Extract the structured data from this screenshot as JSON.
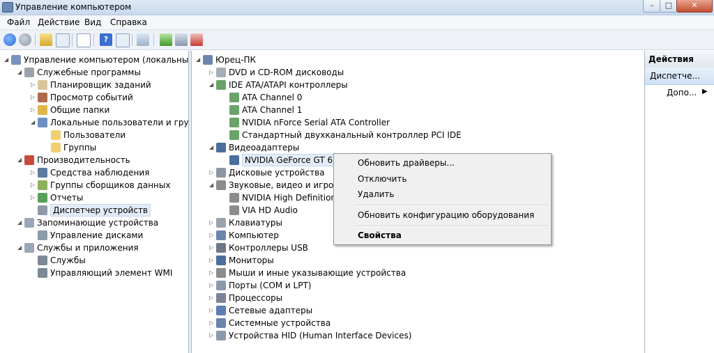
{
  "window": {
    "title": "Управление компьютером",
    "minimize": "–",
    "maximize": "□",
    "close": "✕"
  },
  "menu": [
    "Файл",
    "Действие",
    "Вид",
    "Справка"
  ],
  "toolbar_icons": [
    "back-icon",
    "forward-icon",
    "up-folder-icon",
    "show-hide-tree-icon",
    "properties-icon",
    "help-icon",
    "show-hide-action-icon",
    "scan-hardware-icon",
    "update-driver-icon",
    "disable-device-icon",
    "uninstall-device-icon"
  ],
  "left_tree": [
    {
      "label": "Управление компьютером (локальным)",
      "icon": "computer-management-icon"
    },
    {
      "label": "Служебные программы",
      "icon": "tools-icon"
    },
    {
      "label": "Планировщик заданий",
      "icon": "clock-icon"
    },
    {
      "label": "Просмотр событий",
      "icon": "event-viewer-icon"
    },
    {
      "label": "Общие папки",
      "icon": "shared-folders-icon"
    },
    {
      "label": "Локальные пользователи и группы",
      "icon": "users-groups-icon"
    },
    {
      "label": "Пользователи",
      "icon": "folder-icon"
    },
    {
      "label": "Группы",
      "icon": "folder-icon"
    },
    {
      "label": "Производительность",
      "icon": "performance-icon"
    },
    {
      "label": "Средства наблюдения",
      "icon": "monitor-tools-icon"
    },
    {
      "label": "Группы сборщиков данных",
      "icon": "data-collector-icon"
    },
    {
      "label": "Отчеты",
      "icon": "reports-icon"
    },
    {
      "label": "Диспетчер устройств",
      "icon": "device-manager-icon"
    },
    {
      "label": "Запоминающие устройства",
      "icon": "storage-icon"
    },
    {
      "label": "Управление дисками",
      "icon": "disk-management-icon"
    },
    {
      "label": "Службы и приложения",
      "icon": "services-apps-icon"
    },
    {
      "label": "Службы",
      "icon": "services-gear-icon"
    },
    {
      "label": "Управляющий элемент WMI",
      "icon": "wmi-icon"
    }
  ],
  "device_tree": [
    {
      "label": "Юрец-ПК",
      "icon": "pc-icon"
    },
    {
      "label": "DVD и CD-ROM дисководы",
      "icon": "dvd-drive-icon"
    },
    {
      "label": "IDE ATA/ATAPI контроллеры",
      "icon": "ide-controller-icon"
    },
    {
      "label": "ATA Channel 0",
      "icon": "ide-controller-icon"
    },
    {
      "label": "ATA Channel 1",
      "icon": "ide-controller-icon"
    },
    {
      "label": "NVIDIA nForce Serial ATA Controller",
      "icon": "ide-controller-icon"
    },
    {
      "label": "Стандартный двухканальный контроллер PCI IDE",
      "icon": "ide-controller-icon"
    },
    {
      "label": "Видеоадаптеры",
      "icon": "display-adapter-icon"
    },
    {
      "label": "NVIDIA GeForce GT 610",
      "icon": "display-adapter-icon"
    },
    {
      "label": "Дисковые устройства",
      "icon": "disk-drive-icon"
    },
    {
      "label": "Звуковые, видео и игровые устройства",
      "icon": "speaker-icon"
    },
    {
      "label": "NVIDIA High Definition Audio",
      "icon": "speaker-icon"
    },
    {
      "label": "VIA HD Audio",
      "icon": "speaker-icon"
    },
    {
      "label": "Клавиатуры",
      "icon": "keyboard-icon"
    },
    {
      "label": "Компьютер",
      "icon": "computer-icon"
    },
    {
      "label": "Контроллеры USB",
      "icon": "usb-icon"
    },
    {
      "label": "Мониторы",
      "icon": "monitor-icon"
    },
    {
      "label": "Мыши и иные указывающие устройства",
      "icon": "mouse-icon"
    },
    {
      "label": "Порты (COM и LPT)",
      "icon": "port-icon"
    },
    {
      "label": "Процессоры",
      "icon": "processor-icon"
    },
    {
      "label": "Сетевые адаптеры",
      "icon": "network-adapter-icon"
    },
    {
      "label": "Системные устройства",
      "icon": "system-devices-icon"
    },
    {
      "label": "Устройства HID (Human Interface Devices)",
      "icon": "hid-icon"
    }
  ],
  "actions": {
    "header": "Действия",
    "selected": "Диспетче...",
    "more": "Допо...",
    "more_arrow": "▶"
  },
  "context_menu": {
    "items": [
      "Обновить драйверы...",
      "Отключить",
      "Удалить",
      "Обновить конфигурацию оборудования",
      "Свойства"
    ]
  },
  "colors": {
    "accent": "#3a6ea5",
    "selection": "#e3ecf7"
  }
}
